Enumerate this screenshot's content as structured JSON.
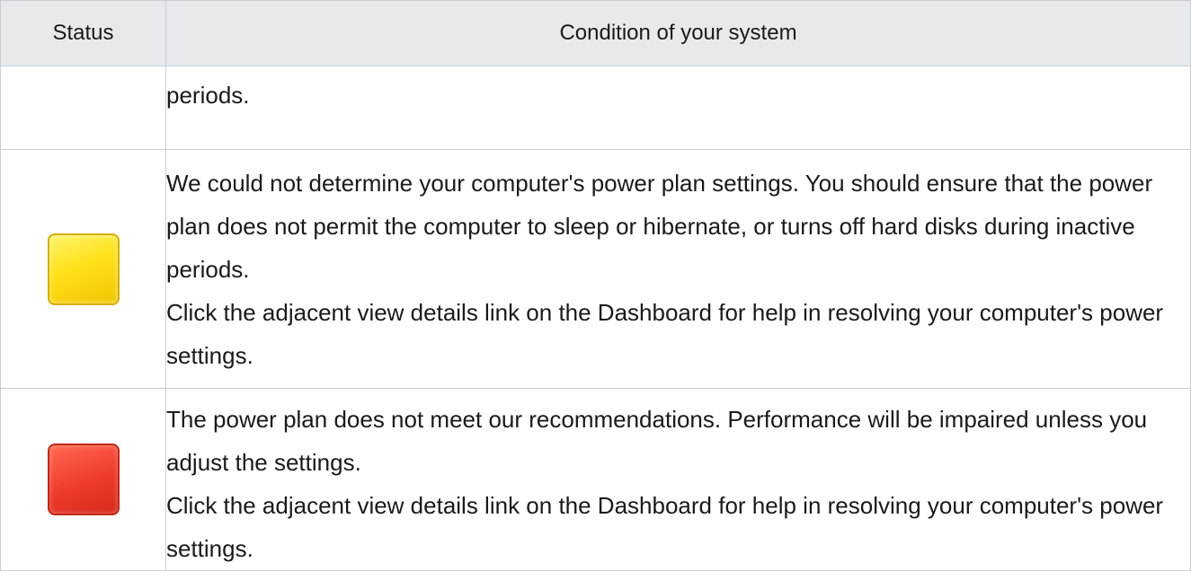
{
  "table": {
    "headers": {
      "status": "Status",
      "condition": "Condition of your system"
    },
    "rows": [
      {
        "status": "none",
        "lines": [
          "periods."
        ]
      },
      {
        "status": "yellow",
        "status_color": "#ffe11a",
        "lines": [
          "We could not determine your computer's power plan settings. You should ensure that the power plan does not permit the computer to sleep or hibernate, or turns off hard disks during inactive periods.",
          "Click the adjacent view details link on the Dashboard for help in resolving your computer's power settings."
        ]
      },
      {
        "status": "red",
        "status_color": "#ee3b2a",
        "lines": [
          "The power plan does not meet our recommendations. Performance will be impaired unless you adjust the settings.",
          "Click the adjacent view details link on the Dashboard for help in resolving your computer's power settings."
        ]
      }
    ]
  }
}
